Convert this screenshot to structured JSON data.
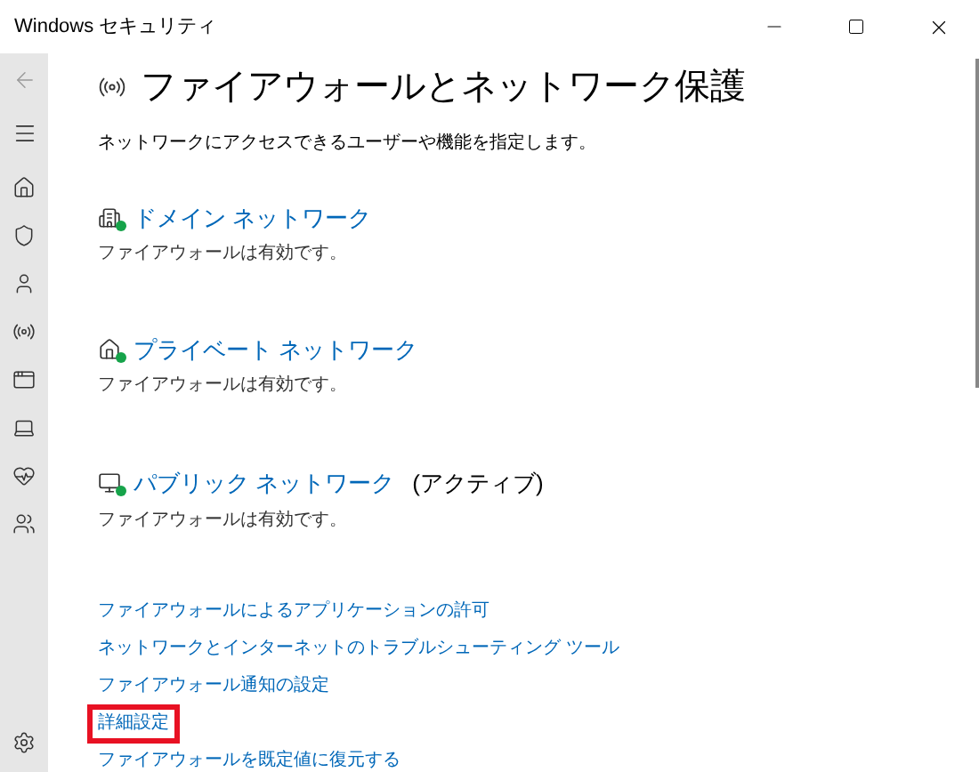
{
  "window": {
    "title": "Windows セキュリティ"
  },
  "page": {
    "title": "ファイアウォールとネットワーク保護",
    "description": "ネットワークにアクセスできるユーザーや機能を指定します。"
  },
  "networks": [
    {
      "kind": "domain",
      "name": "ドメイン ネットワーク",
      "status": "ファイアウォールは有効です。"
    },
    {
      "kind": "private",
      "name": "プライベート ネットワーク",
      "status": "ファイアウォールは有効です。"
    },
    {
      "kind": "public",
      "name": "パブリック ネットワーク",
      "suffix": "(アクティブ)",
      "status": "ファイアウォールは有効です。"
    }
  ],
  "links": [
    {
      "label": "ファイアウォールによるアプリケーションの許可",
      "highlighted": false
    },
    {
      "label": "ネットワークとインターネットのトラブルシューティング ツール",
      "highlighted": false
    },
    {
      "label": "ファイアウォール通知の設定",
      "highlighted": false
    },
    {
      "label": "詳細設定",
      "highlighted": true
    },
    {
      "label": "ファイアウォールを既定値に復元する",
      "highlighted": false
    }
  ]
}
